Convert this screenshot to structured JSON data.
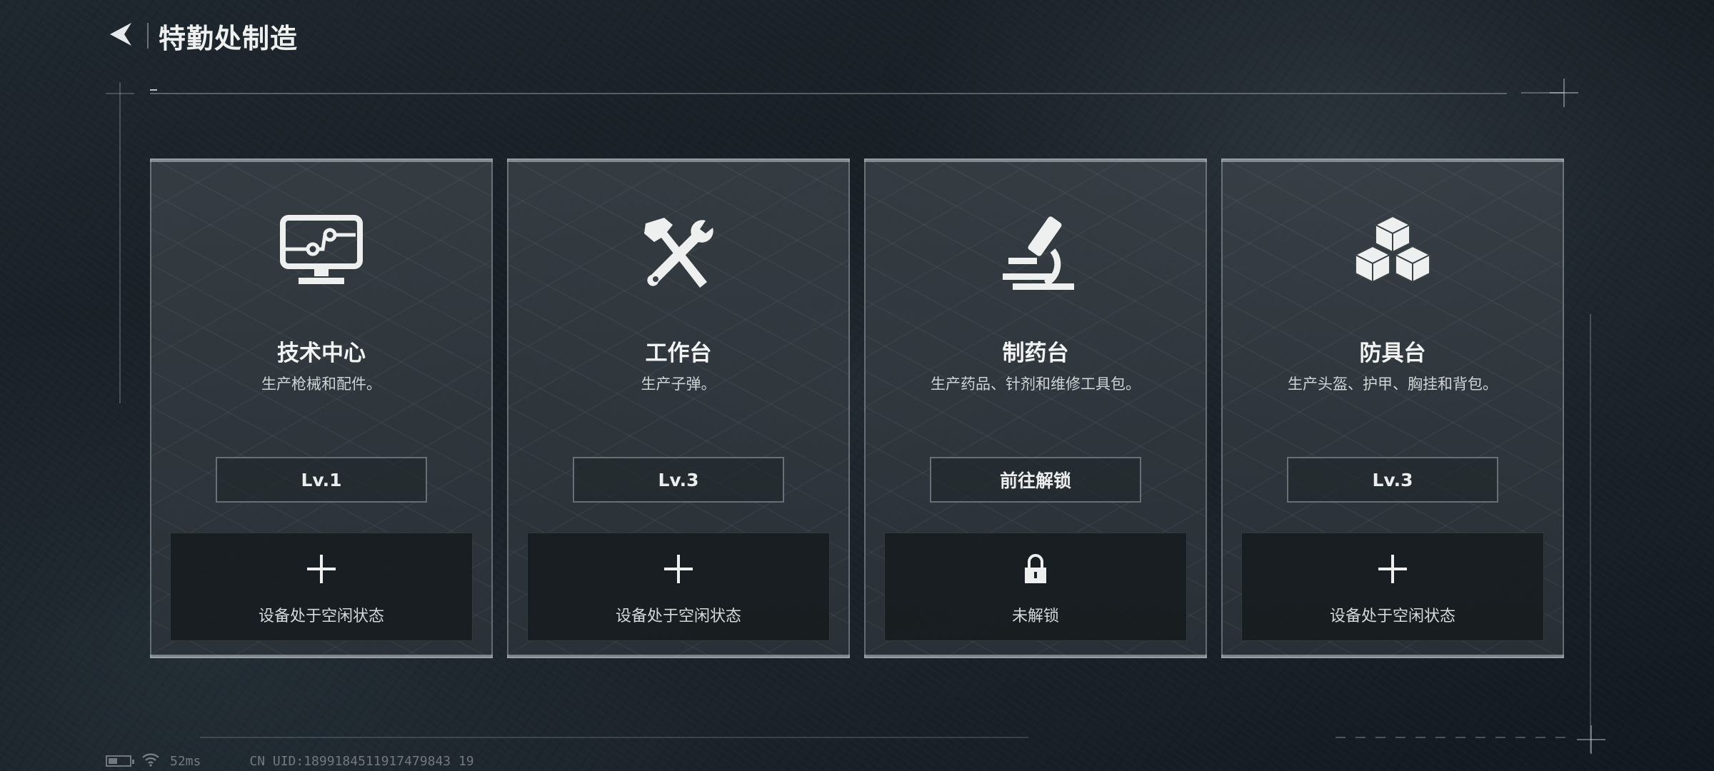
{
  "header": {
    "title": "特勤处制造",
    "back_icon": "back-arrow-icon"
  },
  "stations": [
    {
      "icon": "monitor-circuit-icon",
      "title": "技术中心",
      "desc": "生产枪械和配件。",
      "level": "Lv.1",
      "slot_icon": "plus-icon",
      "slot_label": "设备处于空闲状态"
    },
    {
      "icon": "hammer-wrench-icon",
      "title": "工作台",
      "desc": "生产子弹。",
      "level": "Lv.3",
      "slot_icon": "plus-icon",
      "slot_label": "设备处于空闲状态"
    },
    {
      "icon": "microscope-icon",
      "title": "制药台",
      "desc": "生产药品、针剂和维修工具包。",
      "level": "前往解锁",
      "slot_icon": "lock-icon",
      "slot_label": "未解锁"
    },
    {
      "icon": "boxes-icon",
      "title": "防具台",
      "desc": "生产头盔、护甲、胸挂和背包。",
      "level": "Lv.3",
      "slot_icon": "plus-icon",
      "slot_label": "设备处于空闲状态"
    }
  ],
  "status_bar": {
    "ping": "52ms",
    "uid": "CN UID:1899184511917479843 19"
  },
  "colors": {
    "background": "#1a2228",
    "card_border": "#aab4ba",
    "text": "#eef0f0"
  }
}
